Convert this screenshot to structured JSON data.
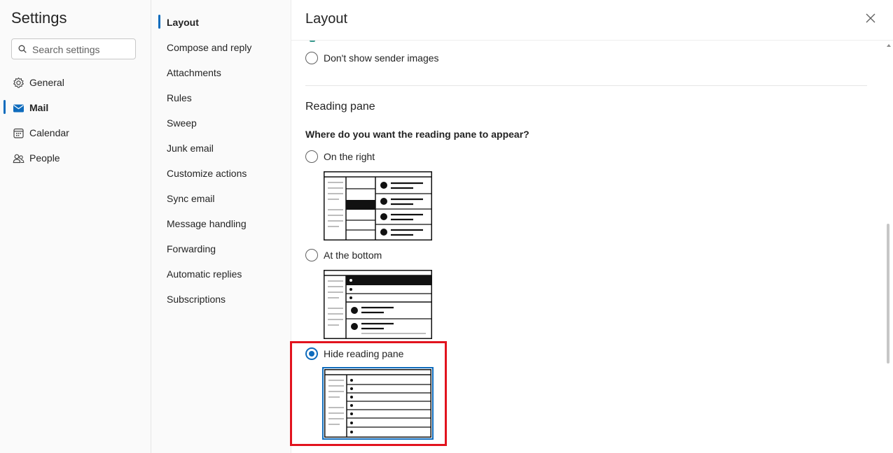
{
  "app": {
    "title": "Settings"
  },
  "search": {
    "placeholder": "Search settings"
  },
  "categories": [
    {
      "label": "General",
      "icon": "gear-icon"
    },
    {
      "label": "Mail",
      "icon": "mail-icon",
      "active": true
    },
    {
      "label": "Calendar",
      "icon": "calendar-icon"
    },
    {
      "label": "People",
      "icon": "people-icon"
    }
  ],
  "subnav": [
    {
      "label": "Layout",
      "active": true
    },
    {
      "label": "Compose and reply"
    },
    {
      "label": "Attachments"
    },
    {
      "label": "Rules"
    },
    {
      "label": "Sweep"
    },
    {
      "label": "Junk email"
    },
    {
      "label": "Customize actions"
    },
    {
      "label": "Sync email"
    },
    {
      "label": "Message handling"
    },
    {
      "label": "Forwarding"
    },
    {
      "label": "Automatic replies"
    },
    {
      "label": "Subscriptions"
    }
  ],
  "main": {
    "title": "Layout",
    "sender_images_option": "Don't show sender images",
    "reading_pane": {
      "heading": "Reading pane",
      "question": "Where do you want the reading pane to appear?",
      "options": [
        {
          "label": "On the right",
          "selected": false
        },
        {
          "label": "At the bottom",
          "selected": false
        },
        {
          "label": "Hide reading pane",
          "selected": true
        }
      ]
    }
  },
  "colors": {
    "accent": "#0f6cbd",
    "highlight": "#e2131e"
  }
}
